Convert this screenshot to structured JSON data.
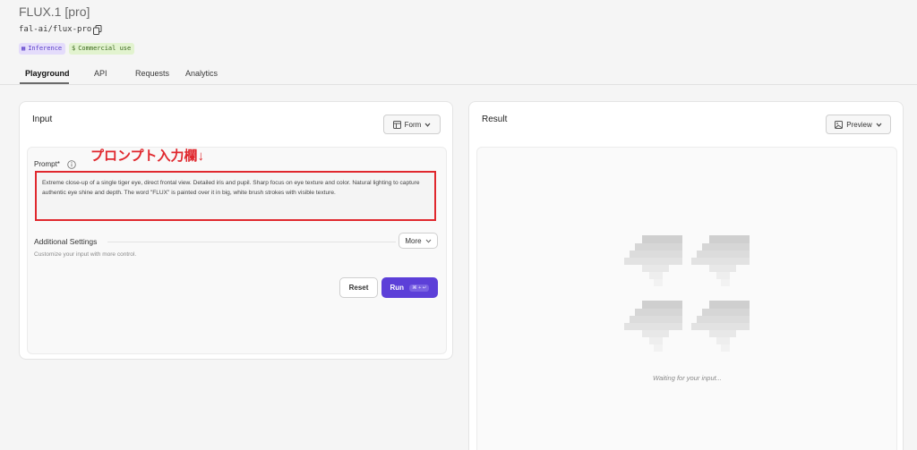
{
  "header": {
    "title": "FLUX.1 [pro]",
    "model_id": "fal-ai/flux-pro",
    "badges": [
      {
        "label": "Inference",
        "icon": "grid-icon",
        "color": "#5b3fc9"
      },
      {
        "label": "Commercial use",
        "icon": "dollar-icon",
        "color": "#3d6a1f"
      }
    ]
  },
  "tabs": [
    {
      "label": "Playground",
      "active": true
    },
    {
      "label": "API",
      "active": false
    },
    {
      "label": "Requests",
      "active": false
    },
    {
      "label": "Analytics",
      "active": false
    }
  ],
  "input_panel": {
    "title": "Input",
    "view_select": "Form",
    "annotation": "プロンプト入力欄↓",
    "prompt": {
      "label": "Prompt*",
      "value": "Extreme close-up of a single tiger eye, direct frontal view. Detailed iris and pupil. Sharp focus on eye texture and color. Natural lighting to capture authentic eye shine and depth. The word \"FLUX\" is painted over it in big, white brush strokes with visible texture."
    },
    "additional_settings": {
      "label": "Additional Settings",
      "more_button": "More",
      "description": "Customize your input with more control."
    },
    "reset_button": "Reset",
    "run_button": "Run",
    "run_shortcut": "⌘ + ↵"
  },
  "result_panel": {
    "title": "Result",
    "view_select": "Preview",
    "status_text": "Waiting for your input..."
  },
  "colors": {
    "accent": "#5c3fd8",
    "annotation": "#e0282e"
  }
}
